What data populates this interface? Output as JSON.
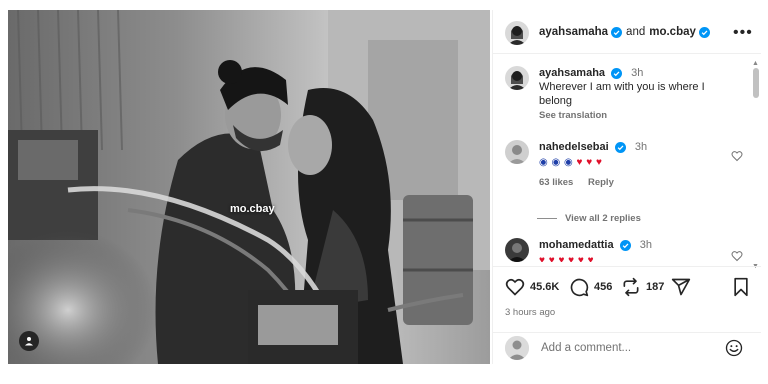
{
  "media": {
    "tag_label": "mo.cbay",
    "user_tag_icon": "person-icon"
  },
  "header": {
    "author1": "ayahsamaha",
    "joiner": "and",
    "author2": "mo.cbay",
    "more_icon": "more-dots-icon"
  },
  "caption": {
    "username": "ayahsamaha",
    "time": "3h",
    "text": "Wherever I am with you is where I belong",
    "see_translation": "See translation"
  },
  "comments": [
    {
      "username": "nahedelsebai",
      "time": "3h",
      "emoji": [
        "◉",
        "◉",
        "◉",
        "♥",
        "♥",
        "♥"
      ],
      "likes": "63 likes",
      "reply": "Reply",
      "view_replies": "View all 2 replies"
    },
    {
      "username": "mohamedattia",
      "time": "3h",
      "emoji": [
        "♥",
        "♥",
        "♥",
        "♥",
        "♥",
        "♥"
      ]
    }
  ],
  "actions": {
    "likes": "45.6K",
    "comments": "456",
    "reposts": "187"
  },
  "posted_ago": "3 hours ago",
  "add_comment": {
    "placeholder": "Add a comment..."
  },
  "colors": {
    "verified_blue": "#0095f6",
    "heart_red": "#e0102b",
    "evil_eye_blue": "#1f3fa8"
  }
}
